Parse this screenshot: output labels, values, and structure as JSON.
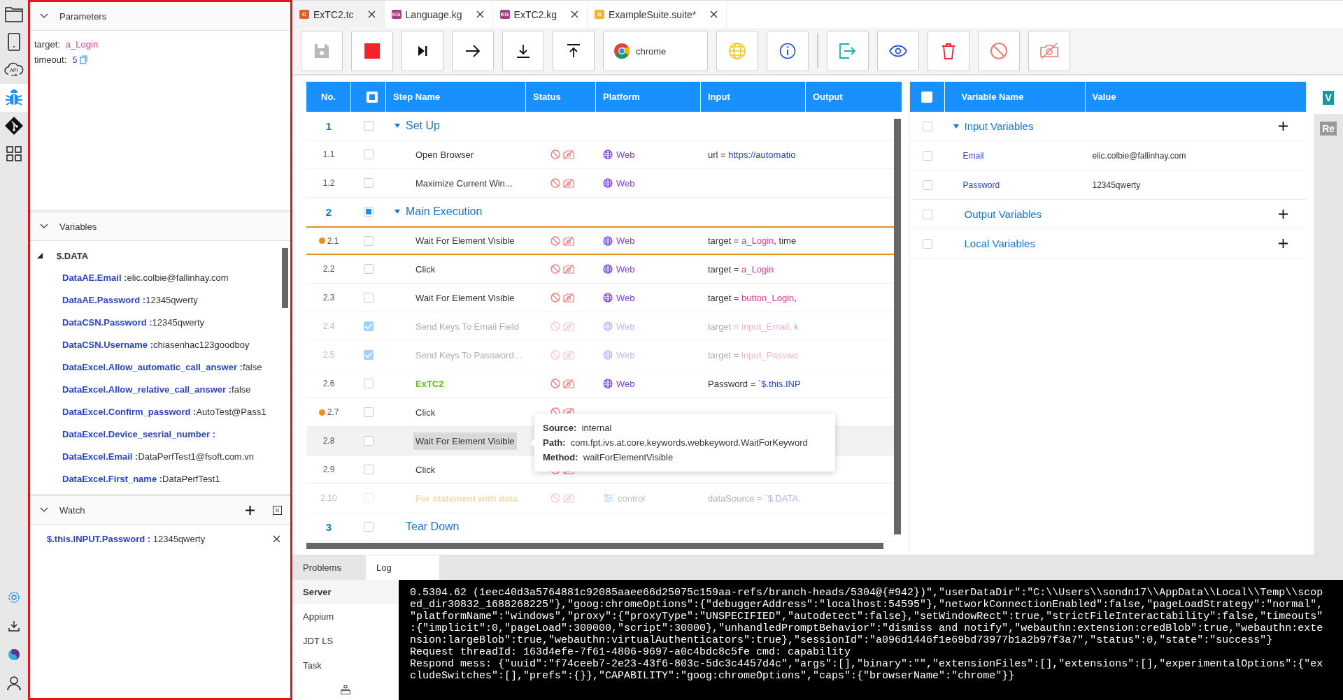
{
  "activity_bar": {
    "top": [
      {
        "kind": "folder",
        "selected": false
      },
      {
        "kind": "device",
        "selected": false
      },
      {
        "kind": "api",
        "label": "API",
        "selected": false
      },
      {
        "kind": "debug",
        "selected": true
      },
      {
        "kind": "git",
        "selected": false
      },
      {
        "kind": "grid",
        "selected": false
      }
    ],
    "bottom": [
      {
        "kind": "settings"
      },
      {
        "kind": "download"
      },
      {
        "kind": "logo"
      },
      {
        "kind": "account"
      }
    ]
  },
  "left_panel": {
    "parameters": {
      "title": "Parameters",
      "items": [
        {
          "name": "target:",
          "value": "a_Login",
          "kind": "object",
          "copyable": false
        },
        {
          "name": "timeout:",
          "value": "5",
          "kind": "number",
          "copyable": true
        }
      ]
    },
    "variables": {
      "title": "Variables",
      "root": {
        "name": "$.DATA",
        "expanded": true,
        "children": [
          {
            "name": "DataAE.Email :",
            "value": "elic.colbie@fallinhay.com"
          },
          {
            "name": "DataAE.Password :",
            "value": "12345qwerty"
          },
          {
            "name": "DataCSN.Password :",
            "value": "12345qwerty"
          },
          {
            "name": "DataCSN.Username :",
            "value": "chiasenhac123goodboy"
          },
          {
            "name": "DataExcel.Allow_automatic_call_answer :",
            "value": "false"
          },
          {
            "name": "DataExcel.Allow_relative_call_answer :",
            "value": "false"
          },
          {
            "name": "DataExcel.Confirm_password :",
            "value": "AutoTest@Pass1"
          },
          {
            "name": "DataExcel.Device_sesrial_number :"
          },
          {
            "name": "DataExcel.Email :",
            "value": "DataPerfTest1@fsoft.com.vn"
          },
          {
            "name": "DataExcel.First_name :",
            "value": "DataPerfTest1"
          }
        ]
      }
    },
    "watch": {
      "title": "Watch",
      "items": [
        {
          "name": "$.this.INPUT.Password :",
          "value": "12345qwerty"
        }
      ]
    }
  },
  "tabs": [
    {
      "label": "ExTC2.tc",
      "badge": "C",
      "color": "#d9622b",
      "selected": true
    },
    {
      "label": "Language.kg",
      "badge": "KG",
      "color": "#b03a8c",
      "selected": false
    },
    {
      "label": "ExTC2.kg",
      "badge": "KG",
      "color": "#b03a8c",
      "selected": false
    },
    {
      "label": "ExampleSuite.suite*",
      "badge": "S",
      "color": "#f5b335",
      "selected": false
    }
  ],
  "toolbar": [
    {
      "kind": "save",
      "disabled": true
    },
    {
      "kind": "stop",
      "disabled": false
    },
    {
      "kind": "step",
      "disabled": false
    },
    {
      "kind": "next",
      "disabled": false
    },
    {
      "kind": "step-into",
      "disabled": false
    },
    {
      "kind": "step-out",
      "disabled": false
    },
    {
      "kind": "browser",
      "label": "chrome",
      "disabled": false
    },
    {
      "kind": "globe",
      "disabled": false
    },
    {
      "kind": "info",
      "disabled": false
    },
    {
      "kind": "separator"
    },
    {
      "kind": "export",
      "disabled": false
    },
    {
      "kind": "eye",
      "disabled": false
    },
    {
      "kind": "delete",
      "disabled": false
    },
    {
      "kind": "ban",
      "disabled": false
    },
    {
      "kind": "camera-off",
      "disabled": false
    }
  ],
  "steps_table": {
    "columns": [
      "No.",
      "Step Name",
      "Status",
      "Platform",
      "Input",
      "Output"
    ],
    "select_all": {
      "indeterminate": true
    },
    "rows": [
      {
        "kind": "group",
        "no": "1",
        "name": "Set Up",
        "expanded": true,
        "checked": false,
        "indeterminate": false
      },
      {
        "kind": "keyword",
        "no": "1.1",
        "name": "Open Browser",
        "checked": false,
        "disabled": false,
        "breakpoint": false,
        "current": false,
        "highlighted": false,
        "status": true,
        "platform": {
          "kind": "web",
          "label": "Web"
        },
        "input": [
          {
            "text": "url = ",
            "kind": "plain"
          },
          {
            "text": "https://automatio",
            "kind": "value"
          }
        ]
      },
      {
        "kind": "keyword",
        "no": "1.2",
        "name": "Maximize Current Win...",
        "checked": false,
        "disabled": false,
        "breakpoint": false,
        "current": false,
        "highlighted": false,
        "status": true,
        "platform": {
          "kind": "web",
          "label": "Web"
        }
      },
      {
        "kind": "group",
        "no": "2",
        "name": "Main Execution",
        "expanded": true,
        "checked": false,
        "indeterminate": true
      },
      {
        "kind": "keyword",
        "no": "2.1",
        "name": "Wait For Element Visible",
        "checked": false,
        "disabled": false,
        "breakpoint": true,
        "current": true,
        "highlighted": false,
        "status": true,
        "platform": {
          "kind": "web",
          "label": "Web"
        },
        "input": [
          {
            "text": "target = ",
            "kind": "plain"
          },
          {
            "text": "a_Login",
            "kind": "object"
          },
          {
            "text": ", time",
            "kind": "plain"
          }
        ]
      },
      {
        "kind": "keyword",
        "no": "2.2",
        "name": "Click",
        "checked": false,
        "disabled": false,
        "breakpoint": false,
        "current": false,
        "highlighted": false,
        "status": true,
        "platform": {
          "kind": "web",
          "label": "Web"
        },
        "input": [
          {
            "text": "target = ",
            "kind": "plain"
          },
          {
            "text": "a_Login",
            "kind": "object"
          }
        ]
      },
      {
        "kind": "keyword",
        "no": "2.3",
        "name": "Wait For Element Visible",
        "checked": false,
        "disabled": false,
        "breakpoint": false,
        "current": false,
        "highlighted": false,
        "status": true,
        "platform": {
          "kind": "web",
          "label": "Web"
        },
        "input": [
          {
            "text": "target = ",
            "kind": "plain"
          },
          {
            "text": "button_Login",
            "kind": "object"
          },
          {
            "text": ",",
            "kind": "plain"
          }
        ]
      },
      {
        "kind": "keyword",
        "no": "2.4",
        "name": "Send Keys To Email Field",
        "checked": true,
        "disabled": true,
        "breakpoint": false,
        "current": false,
        "highlighted": false,
        "status": true,
        "platform": {
          "kind": "web",
          "label": "Web"
        },
        "input": [
          {
            "text": "target = ",
            "kind": "plain"
          },
          {
            "text": "input_Email",
            "kind": "object"
          },
          {
            "text": ", k",
            "kind": "plain"
          }
        ]
      },
      {
        "kind": "keyword",
        "no": "2.5",
        "name": "Send Keys To Password...",
        "checked": true,
        "disabled": true,
        "breakpoint": false,
        "current": false,
        "highlighted": false,
        "status": true,
        "platform": {
          "kind": "web",
          "label": "Web"
        },
        "input": [
          {
            "text": "target = ",
            "kind": "plain"
          },
          {
            "text": "input_Passwo",
            "kind": "object"
          }
        ]
      },
      {
        "kind": "testcase",
        "no": "2.6",
        "name": "ExTC2",
        "checked": false,
        "disabled": false,
        "breakpoint": false,
        "current": false,
        "highlighted": false,
        "status": true,
        "platform": {
          "kind": "web",
          "label": "Web"
        },
        "input": [
          {
            "text": "Password = ",
            "kind": "plain"
          },
          {
            "text": "`$.this.INP",
            "kind": "value"
          }
        ]
      },
      {
        "kind": "keyword",
        "no": "2.7",
        "name": "Click",
        "checked": false,
        "disabled": false,
        "breakpoint": true,
        "current": false,
        "highlighted": false,
        "status": true
      },
      {
        "kind": "keyword",
        "no": "2.8",
        "name": "Wait For Element Visible",
        "checked": false,
        "disabled": false,
        "breakpoint": false,
        "current": false,
        "highlighted": true,
        "status": false
      },
      {
        "kind": "keyword",
        "no": "2.9",
        "name": "Click",
        "checked": false,
        "disabled": false,
        "breakpoint": false,
        "current": false,
        "highlighted": false,
        "status": true
      },
      {
        "kind": "control",
        "no": "2.10",
        "name": "For statement with data",
        "checked": false,
        "disabled": true,
        "breakpoint": false,
        "current": false,
        "highlighted": false,
        "status": true,
        "platform": {
          "kind": "control",
          "label": "control"
        },
        "input": [
          {
            "text": "dataSource = ",
            "kind": "plain"
          },
          {
            "text": "`$.DATA.",
            "kind": "value"
          }
        ]
      },
      {
        "kind": "group",
        "no": "3",
        "name": "Tear Down",
        "expanded": false,
        "checked": false,
        "indeterminate": false
      }
    ],
    "tooltip": {
      "lines": [
        {
          "label": "Source:",
          "value": "internal"
        },
        {
          "label": "Path:",
          "value": "com.fpt.ivs.at.core.keywords.webkeyword.WaitForKeyword"
        },
        {
          "label": "Method:",
          "value": "waitForElementVisible"
        }
      ]
    }
  },
  "variables_table": {
    "columns": [
      "Variable Name",
      "Value"
    ],
    "select_all": {
      "checked": false
    },
    "groups": [
      {
        "name": "Input Variables",
        "expanded": true,
        "checked": false,
        "children": [
          {
            "name": "Email",
            "value": "elic.colbie@fallinhay.com",
            "checked": false
          },
          {
            "name": "Password",
            "value": "12345qwerty",
            "checked": false
          }
        ]
      },
      {
        "name": "Output Variables",
        "expanded": false,
        "checked": false
      },
      {
        "name": "Local Variables",
        "expanded": false,
        "checked": false
      }
    ]
  },
  "side_strip": [
    {
      "label": "V",
      "selected": true
    },
    {
      "label": "Re",
      "selected": false
    }
  ],
  "bottom_panel": {
    "tabs": [
      {
        "label": "Problems",
        "selected": false
      },
      {
        "label": "Log",
        "selected": true
      }
    ],
    "sources": [
      {
        "label": "Server",
        "selected": true
      },
      {
        "label": "Appium",
        "selected": false
      },
      {
        "label": "JDT LS",
        "selected": false
      },
      {
        "label": "Task",
        "selected": false
      }
    ],
    "log_lines": [
      "0.5304.62 (1eec40d3a5764881c92085aaee66d25075c159aa-refs/branch-heads/5304@{#942})\",\"userDataDir\":\"C:\\\\Users\\\\sondn17\\\\AppData\\\\Local\\\\Temp\\\\scop",
      "ed_dir30832_1688268225\"},\"goog:chromeOptions\":{\"debuggerAddress\":\"localhost:54595\"},\"networkConnectionEnabled\":false,\"pageLoadStrategy\":\"normal\",",
      "\"platformName\":\"windows\",\"proxy\":{\"proxyType\":\"UNSPECIFIED\",\"autodetect\":false},\"setWindowRect\":true,\"strictFileInteractability\":false,\"timeouts\"",
      ":{\"implicit\":0,\"pageLoad\":300000,\"script\":30000},\"unhandledPromptBehavior\":\"dismiss and notify\",\"webauthn:extension:credBlob\":true,\"webauthn:exte",
      "nsion:largeBlob\":true,\"webauthn:virtualAuthenticators\":true},\"sessionId\":\"a096d1446f1e69bd73977b1a2b97f3a7\",\"status\":0,\"state\":\"success\"}",
      "Request threadId: 163d4efe-7f61-4806-9697-a0c4bdc8c5fe cmd: capability",
      "Respond mess: {\"uuid\":\"f74ceeb7-2e23-43f6-803c-5dc3c4457d4c\",\"args\":[],\"binary\":\"\",\"extensionFiles\":[],\"extensions\":[],\"experimentalOptions\":{\"ex",
      "cludeSwitches\":[],\"prefs\":{}},\"CAPABILITY\":\"goog:chromeOptions\",\"caps\":{\"browserName\":\"chrome\"}}"
    ]
  }
}
